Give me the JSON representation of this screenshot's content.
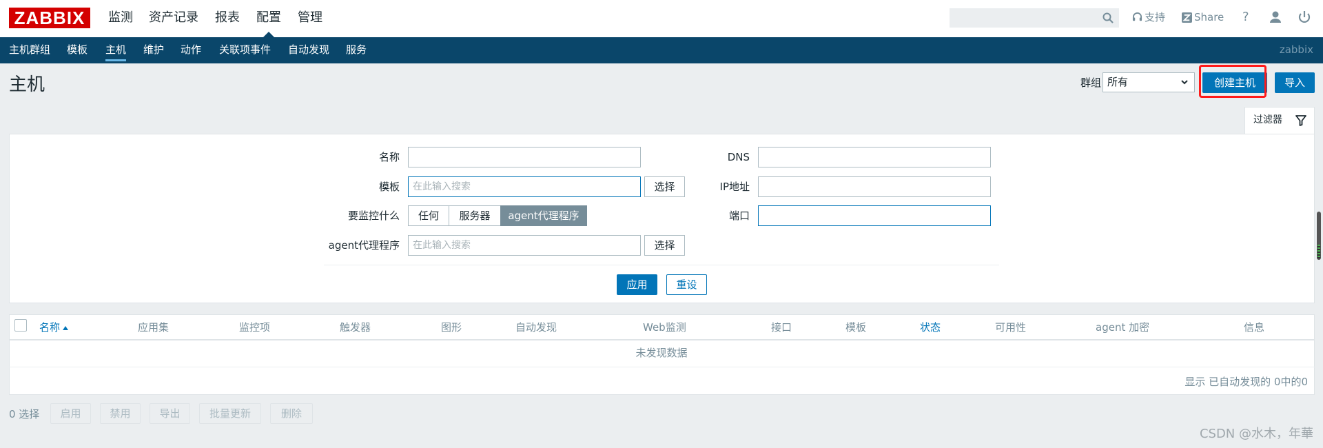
{
  "logo": "ZABBIX",
  "top_nav": [
    "监测",
    "资产记录",
    "报表",
    "配置",
    "管理"
  ],
  "header": {
    "search_placeholder": "",
    "support_label": "支持",
    "share_label": "Share",
    "help_label": "?"
  },
  "sub_nav": [
    "主机群组",
    "模板",
    "主机",
    "维护",
    "动作",
    "关联项事件",
    "自动发现",
    "服务"
  ],
  "sub_nav_right": "zabbix",
  "page": {
    "title": "主机",
    "group_label": "群组",
    "group_value": "所有",
    "create_button": "创建主机",
    "import_button": "导入"
  },
  "filter": {
    "tab_label": "过滤器",
    "name_label": "名称",
    "template_label": "模板",
    "template_placeholder": "在此输入搜索",
    "select_label": "选择",
    "monitor_label": "要监控什么",
    "monitor_options": [
      "任何",
      "服务器",
      "agent代理程序"
    ],
    "proxy_label": "agent代理程序",
    "proxy_placeholder": "在此输入搜索",
    "dns_label": "DNS",
    "ip_label": "IP地址",
    "port_label": "端口",
    "apply_button": "应用",
    "reset_button": "重设"
  },
  "table": {
    "columns": [
      "名称",
      "应用集",
      "监控项",
      "触发器",
      "图形",
      "自动发现",
      "Web监测",
      "接口",
      "模板",
      "状态",
      "可用性",
      "agent 加密",
      "信息"
    ],
    "empty_text": "未发现数据",
    "footer": "显示 已自动发现的 0中的0"
  },
  "actions": {
    "selected": "0 选择",
    "buttons": [
      "启用",
      "禁用",
      "导出",
      "批量更新",
      "删除"
    ]
  },
  "watermark": "CSDN @水木，年華",
  "colors": {
    "brand_red": "#d40000",
    "nav_bg": "#0a466a",
    "primary_blue": "#0275b8",
    "highlight_red": "#ff1a1a"
  }
}
